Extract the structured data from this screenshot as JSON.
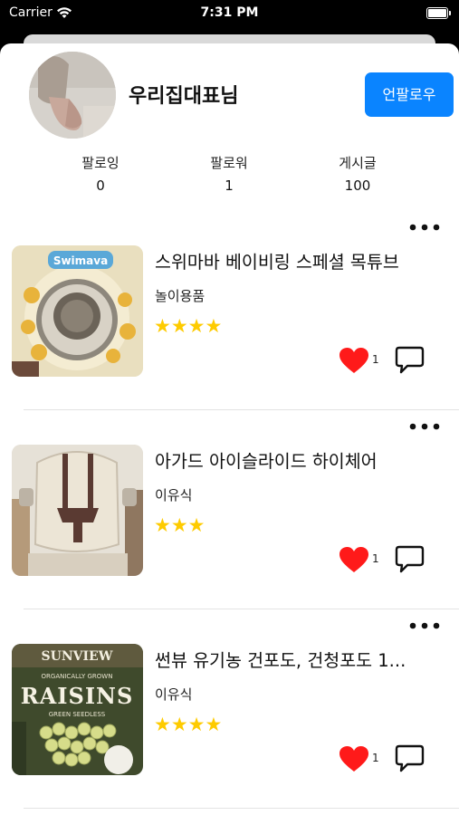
{
  "status_bar": {
    "carrier": "Carrier",
    "time": "7:31 PM"
  },
  "profile": {
    "name": "우리집대표님",
    "unfollow_label": "언팔로우",
    "stats": [
      {
        "label": "팔로잉",
        "value": "0"
      },
      {
        "label": "팔로워",
        "value": "1"
      },
      {
        "label": "게시글",
        "value": "100"
      }
    ]
  },
  "posts": [
    {
      "title": "스위마바 베이비링 스페셜 목튜브",
      "category": "놀이용품",
      "rating": 4,
      "stars": "★★★★",
      "likes": "1"
    },
    {
      "title": "아가드 아이슬라이드 하이체어",
      "category": "이유식",
      "rating": 3,
      "stars": "★★★",
      "likes": "1"
    },
    {
      "title": "썬뷰 유기농 건포도, 건청포도 1...",
      "category": "이유식",
      "rating": 4,
      "stars": "★★★★",
      "likes": "1"
    }
  ],
  "thumbnail_text": {
    "post0": "Swimava",
    "post2_brand": "SUNVIEW",
    "post2_sub": "ORGANICALLY GROWN",
    "post2_product": "RAISINS",
    "post2_variety": "GREEN SEEDLESS"
  },
  "colors": {
    "accent": "#0a84ff",
    "star": "#fecb00",
    "heart": "#ff1a1a"
  },
  "icons": [
    "wifi-icon",
    "battery-icon",
    "more-icon",
    "heart-icon",
    "comment-icon"
  ]
}
